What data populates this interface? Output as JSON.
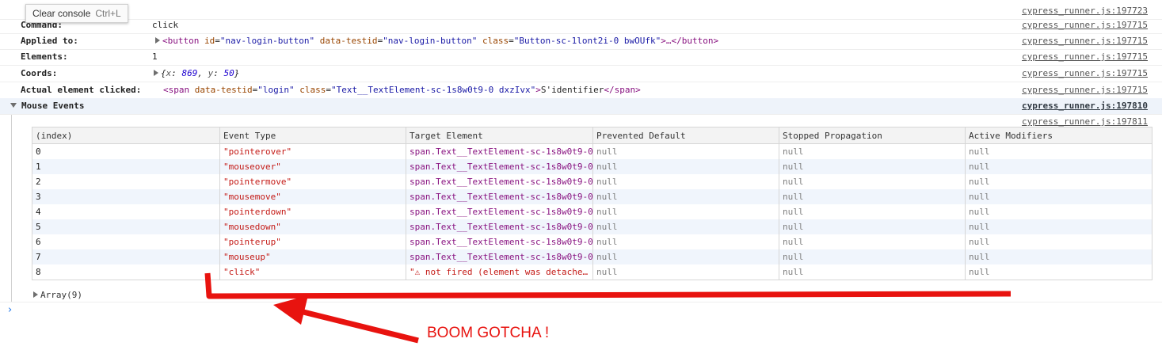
{
  "tooltip": {
    "label": "Clear console",
    "shortcut": "Ctrl+L"
  },
  "rows": {
    "top_src": "cypress_runner.js:197723",
    "command": {
      "label": "Command:",
      "value": "click",
      "src": "cypress_runner.js:197715"
    },
    "applied": {
      "label": "Applied to:",
      "tag_open": "<button",
      "attrs": [
        {
          "name": "id",
          "value": "\"nav-login-button\""
        },
        {
          "name": "data-testid",
          "value": "\"nav-login-button\""
        },
        {
          "name": "class",
          "value": "\"Button-sc-1lont2i-0 bwOUfk\""
        }
      ],
      "tail": ">…</button>",
      "src": "cypress_runner.js:197715"
    },
    "elements": {
      "label": "Elements:",
      "value": "1",
      "src": "cypress_runner.js:197715"
    },
    "coords": {
      "label": "Coords:",
      "open": "{",
      "x_key": "x",
      "x_val": "869",
      "y_key": "y",
      "y_val": "50",
      "close": "}",
      "src": "cypress_runner.js:197715"
    },
    "actual": {
      "label": "Actual element clicked:",
      "tag_open": "<span",
      "attrs": [
        {
          "name": "data-testid",
          "value": "\"login\""
        },
        {
          "name": "class",
          "value": "\"Text__TextElement-sc-1s8w0t9-0 dxzIvx\""
        }
      ],
      "text": "S'identifier",
      "tag_close": "</span>",
      "src": "cypress_runner.js:197715"
    },
    "mouse": {
      "label": "Mouse Events",
      "src": "cypress_runner.js:197810"
    },
    "table_src": "cypress_runner.js:197811"
  },
  "table": {
    "headers": [
      "(index)",
      "Event Type",
      "Target Element",
      "Prevented Default",
      "Stopped Propagation",
      "Active Modifiers"
    ],
    "rows": [
      [
        "0",
        "\"pointerover\"",
        "span.Text__TextElement-sc-1s8w0t9-0",
        "null",
        "null",
        "null"
      ],
      [
        "1",
        "\"mouseover\"",
        "span.Text__TextElement-sc-1s8w0t9-0",
        "null",
        "null",
        "null"
      ],
      [
        "2",
        "\"pointermove\"",
        "span.Text__TextElement-sc-1s8w0t9-0",
        "null",
        "null",
        "null"
      ],
      [
        "3",
        "\"mousemove\"",
        "span.Text__TextElement-sc-1s8w0t9-0",
        "null",
        "null",
        "null"
      ],
      [
        "4",
        "\"pointerdown\"",
        "span.Text__TextElement-sc-1s8w0t9-0",
        "null",
        "null",
        "null"
      ],
      [
        "5",
        "\"mousedown\"",
        "span.Text__TextElement-sc-1s8w0t9-0",
        "null",
        "null",
        "null"
      ],
      [
        "6",
        "\"pointerup\"",
        "span.Text__TextElement-sc-1s8w0t9-0",
        "null",
        "null",
        "null"
      ],
      [
        "7",
        "\"mouseup\"",
        "span.Text__TextElement-sc-1s8w0t9-0",
        "null",
        "null",
        "null"
      ],
      [
        "8",
        "\"click\"",
        "\"⚠ not fired (element was detache…",
        "null",
        "null",
        "null"
      ]
    ]
  },
  "array_label": "Array(9)",
  "prompt": "›",
  "annotation": "BOOM GOTCHA !",
  "colors": {
    "annotation": "#e8130f",
    "link": "#545454"
  }
}
